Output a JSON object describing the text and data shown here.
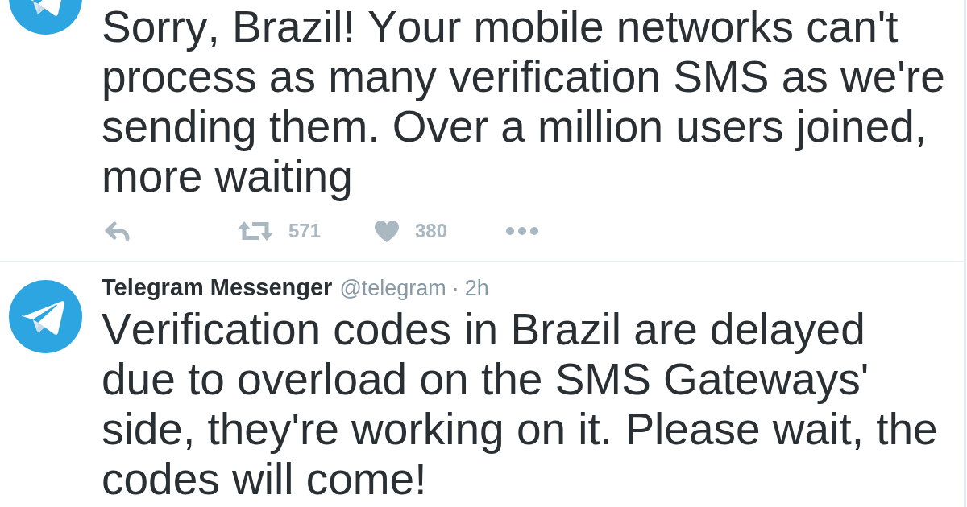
{
  "tweets": [
    {
      "text": "Sorry, Brazil! Your mobile networks can't process as many verification SMS as we're sending them. Over a million users joined, more waiting",
      "actions": {
        "retweets": "571",
        "likes": "380"
      }
    },
    {
      "author": {
        "name": "Telegram Messenger",
        "handle": "@telegram"
      },
      "separator": "·",
      "time": "2h",
      "text": "Verification codes in Brazil are delayed due to overload on the SMS Gateways' side, they're working on it. Please wait, the codes will come!"
    }
  ]
}
